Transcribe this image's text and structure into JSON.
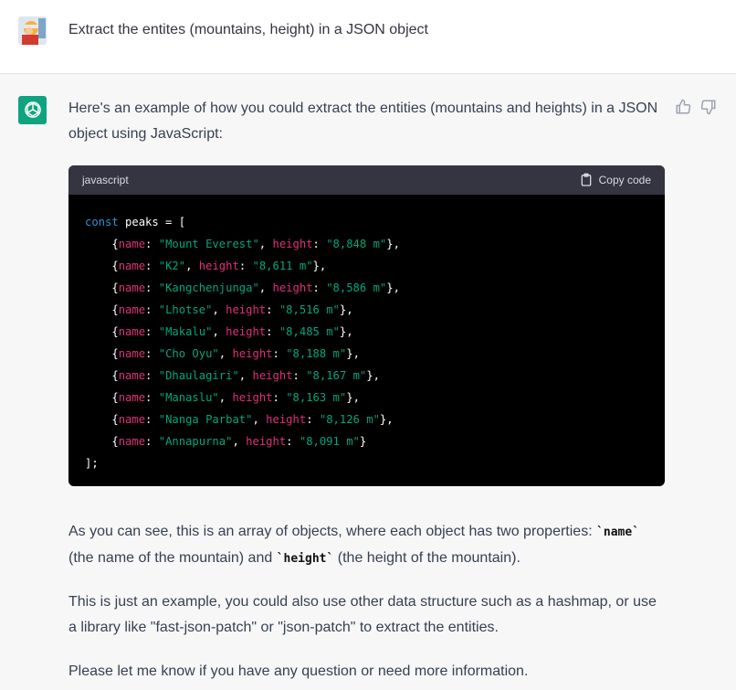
{
  "user": {
    "message": "Extract the entites (mountains, height) in a JSON object"
  },
  "assistant": {
    "intro": "Here's an example of how you could extract the entities (mountains and heights) in a JSON object using JavaScript:",
    "code": {
      "language": "javascript",
      "copy_label": "Copy code",
      "decl_keyword": "const",
      "var_name": "peaks",
      "key_name": "name",
      "key_height": "height",
      "entries": [
        {
          "name": "\"Mount Everest\"",
          "height": "\"8,848 m\""
        },
        {
          "name": "\"K2\"",
          "height": "\"8,611 m\""
        },
        {
          "name": "\"Kangchenjunga\"",
          "height": "\"8,586 m\""
        },
        {
          "name": "\"Lhotse\"",
          "height": "\"8,516 m\""
        },
        {
          "name": "\"Makalu\"",
          "height": "\"8,485 m\""
        },
        {
          "name": "\"Cho Oyu\"",
          "height": "\"8,188 m\""
        },
        {
          "name": "\"Dhaulagiri\"",
          "height": "\"8,167 m\""
        },
        {
          "name": "\"Manaslu\"",
          "height": "\"8,163 m\""
        },
        {
          "name": "\"Nanga Parbat\"",
          "height": "\"8,126 m\""
        },
        {
          "name": "\"Annapurna\"",
          "height": "\"8,091 m\""
        }
      ]
    },
    "para1_a": "As you can see, this is an array of objects, where each object has two properties: ",
    "para1_code1": "`name`",
    "para1_b": "(the name of the mountain) and ",
    "para1_code2": "`height`",
    "para1_c": " (the height of the mountain).",
    "para2": "This is just an example, you could also use other data structure such as a hashmap, or use a library like \"fast-json-patch\" or \"json-patch\" to extract the entities.",
    "para3": "Please let me know if you have any question or need more information."
  },
  "colors": {
    "accent": "#10a37f",
    "code_bg": "#000000",
    "code_header_bg": "#343541",
    "keyword": "#2e95d3",
    "property": "#df3079",
    "string": "#00a67d"
  }
}
